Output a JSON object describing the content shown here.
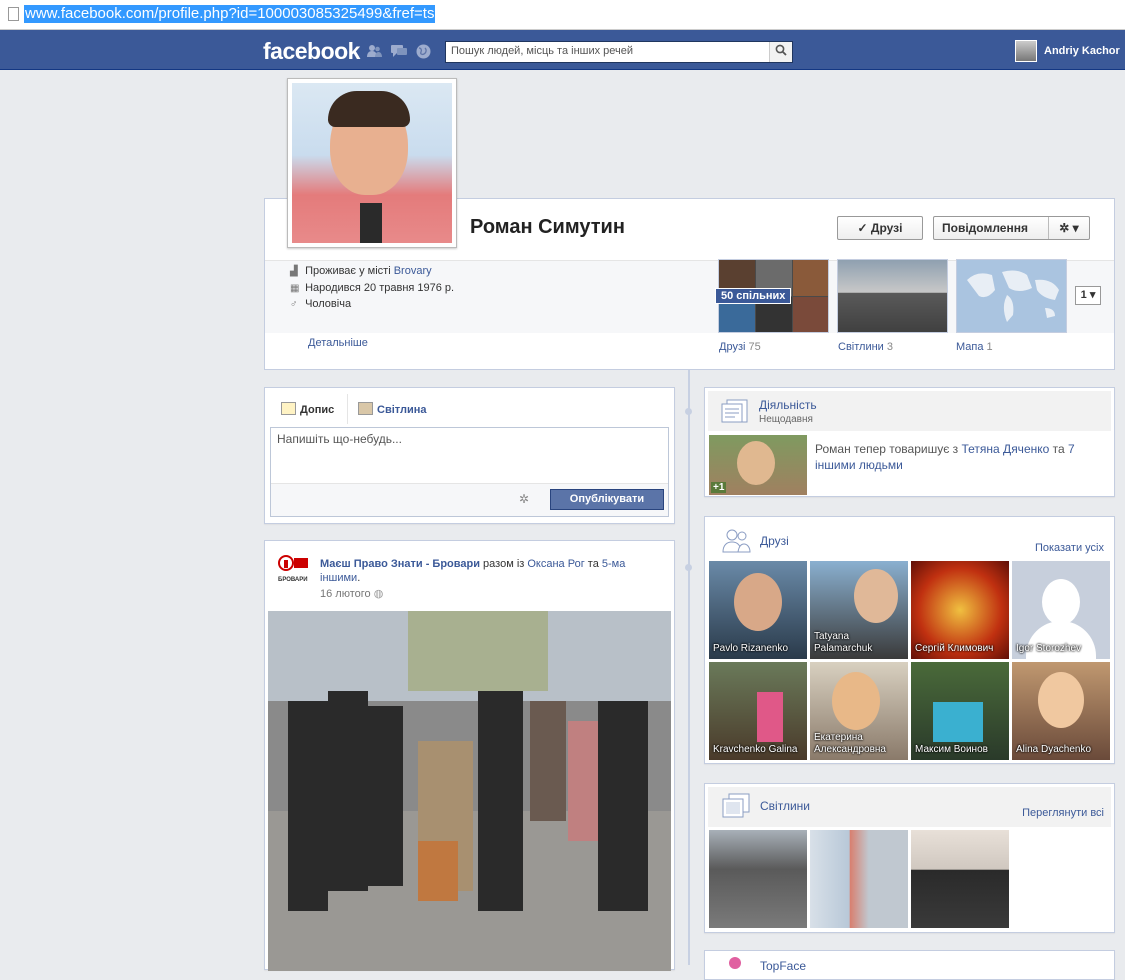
{
  "browser": {
    "url": "www.facebook.com/profile.php?id=100003085325499&fref=ts"
  },
  "topbar": {
    "logo": "facebook",
    "search_placeholder": "Пошук людей, місць та інших речей",
    "user_name": "Andriy Kachor",
    "icons": [
      "friend-requests-icon",
      "messages-icon",
      "notifications-globe-icon",
      "magnifier-icon"
    ]
  },
  "profile": {
    "name": "Роман Симутин",
    "friends_button": "✓ Друзі",
    "message_button": "Повідомлення",
    "settings_icon": "gear-icon",
    "lives_in_prefix": "Проживає у місті ",
    "lives_in_city": "Brovary",
    "born": "Народився 20 травня 1976 р.",
    "gender": "Чоловіча",
    "details_link": "Детальніше",
    "mutual_badge": "50 спільних",
    "sections": [
      {
        "label": "Друзі",
        "count": "75"
      },
      {
        "label": "Світлини",
        "count": "3"
      },
      {
        "label": "Мапа",
        "count": "1"
      }
    ],
    "more_count": "1"
  },
  "composer": {
    "tab_post": "Допис",
    "tab_photo": "Світлина",
    "placeholder": "Напишіть що-небудь...",
    "publish_button": "Опублікувати"
  },
  "post": {
    "page_name": "Маєш Право Знати - Бровари",
    "with_text": " разом із ",
    "with_person": "Оксана Рог",
    "and_text": " та ",
    "others_link": "5-ма іншими",
    "others_suffix": ".",
    "date": "16 лютого",
    "logo_text": "БРОВАРИ"
  },
  "activity": {
    "title": "Діяльність",
    "subtitle": "Нещодавня",
    "text_prefix": "Роман тепер товаришує з ",
    "friend_link": "Тетяна Дяченко",
    "text_mid": " та ",
    "others_link": "7 іншими людьми",
    "badge": "+1"
  },
  "friends": {
    "title": "Друзі",
    "see_all": "Показати усіх",
    "list": [
      {
        "name": "Pavlo Rizanenko"
      },
      {
        "name": "Tatyana Palamarchuk"
      },
      {
        "name": "Сергій Климович"
      },
      {
        "name": "Igor Storozhev"
      },
      {
        "name": "Kravchenko Galina"
      },
      {
        "name": "Екатерина Александровна"
      },
      {
        "name": "Максим Воинов"
      },
      {
        "name": "Alina Dyachenko"
      }
    ]
  },
  "photos": {
    "title": "Світлини",
    "see_all": "Переглянути всі"
  },
  "next_section": {
    "title": "TopFace"
  },
  "colors": {
    "brand": "#3b5998",
    "publish": "#5b74a8",
    "link": "#3b5998"
  }
}
